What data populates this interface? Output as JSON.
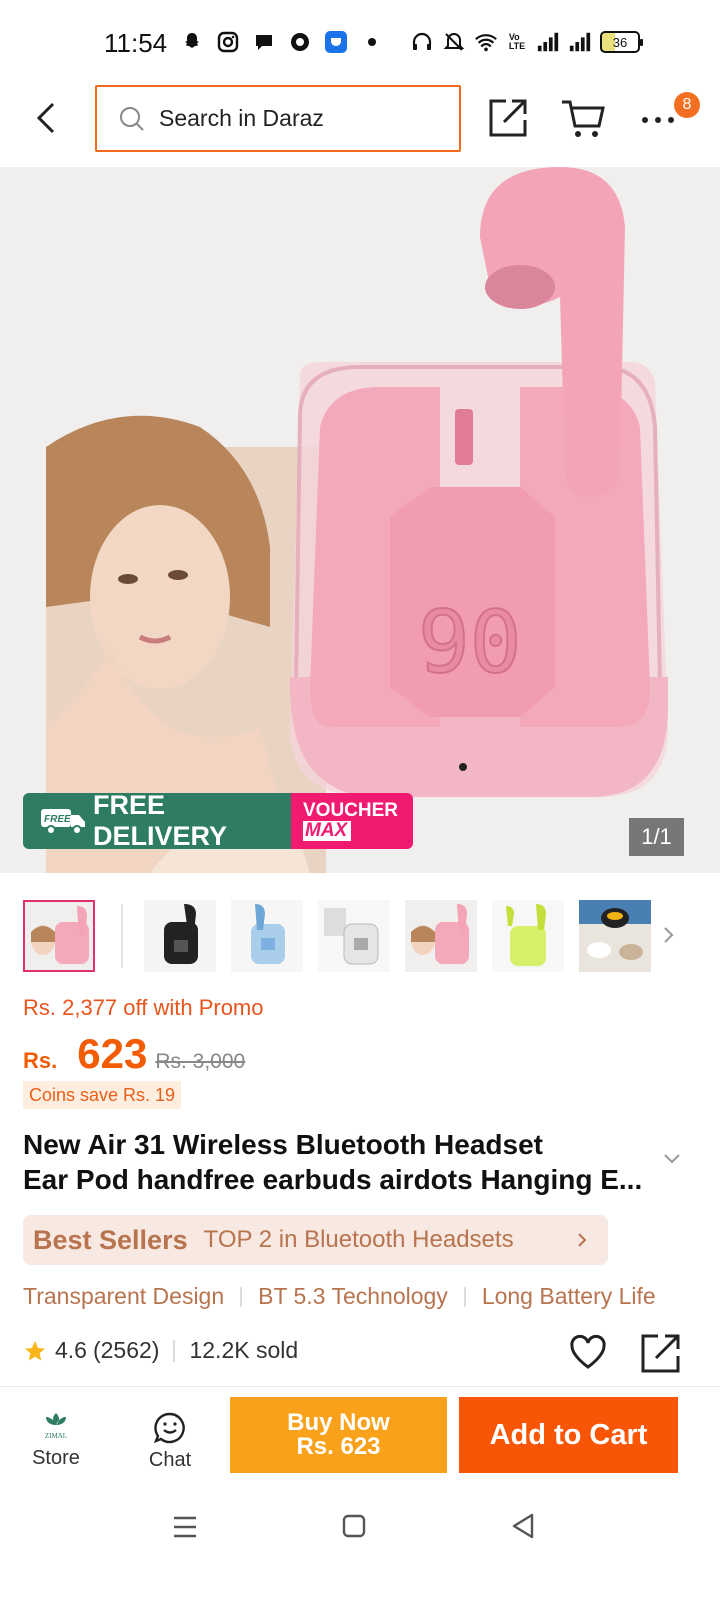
{
  "status_bar": {
    "time": "11:54",
    "battery": "36",
    "network_label": "Vo LTE2"
  },
  "header": {
    "search_placeholder": "Search in Daraz",
    "more_badge": "8"
  },
  "gallery": {
    "banner_free": "FREE DELIVERY",
    "banner_free_tag": "FREE",
    "banner_voucher_line1": "VOUCHER",
    "banner_voucher_line2": "MAX",
    "counter": "1/1",
    "main_lcd": "90"
  },
  "thumbnails": [
    {
      "label": "pink-earbuds-model",
      "selected": true
    },
    {
      "label": "black-earbuds"
    },
    {
      "label": "blue-earbuds"
    },
    {
      "label": "white-earbuds-box"
    },
    {
      "label": "pink-earbuds-model-2"
    },
    {
      "label": "green-earbuds"
    },
    {
      "label": "earbuds-lifestyle"
    }
  ],
  "price": {
    "promo": "Rs. 2,377 off with Promo",
    "currency": "Rs.",
    "value": "623",
    "original": "Rs. 3,000",
    "coins": "Coins save Rs. 19"
  },
  "product": {
    "title_line1": "New Air 31 Wireless Bluetooth Headset",
    "title_line2": "Ear Pod handfree earbuds airdots Hanging E..."
  },
  "best_seller": {
    "label": "Best Sellers",
    "text": "TOP 2 in Bluetooth Headsets"
  },
  "features": [
    "Transparent Design",
    "BT 5.3 Technology",
    "Long Battery Life"
  ],
  "rating": {
    "score": "4.6",
    "count": "(2562)",
    "sold": "12.2K sold"
  },
  "actions": {
    "store_label": "Store",
    "store_logo_text": "ZIMAL",
    "chat_label": "Chat",
    "buy_now_line1": "Buy Now",
    "buy_now_line2": "Rs. 623",
    "add_to_cart": "Add to Cart"
  },
  "colors": {
    "accent": "#f85606",
    "buy_now": "#f9a11b",
    "free_delivery": "#2e7c64",
    "voucher": "#f01a70",
    "price": "#f25c05"
  }
}
